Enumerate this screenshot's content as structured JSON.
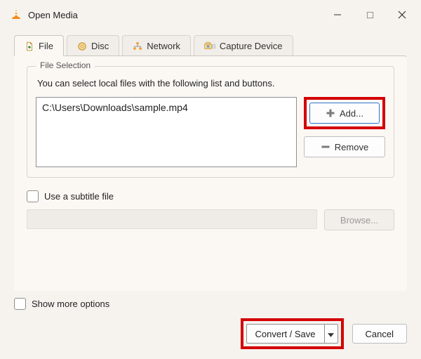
{
  "window": {
    "title": "Open Media"
  },
  "tabs": {
    "file": "File",
    "disc": "Disc",
    "network": "Network",
    "capture": "Capture Device"
  },
  "file_selection": {
    "legend": "File Selection",
    "instruction": "You can select local files with the following list and buttons.",
    "files": [
      "C:\\Users\\Downloads\\sample.mp4"
    ],
    "add_label": "Add...",
    "remove_label": "Remove"
  },
  "subtitle": {
    "checkbox_label": "Use a subtitle file",
    "browse_label": "Browse..."
  },
  "more_options_label": "Show more options",
  "actions": {
    "convert_save": "Convert / Save",
    "cancel": "Cancel"
  }
}
